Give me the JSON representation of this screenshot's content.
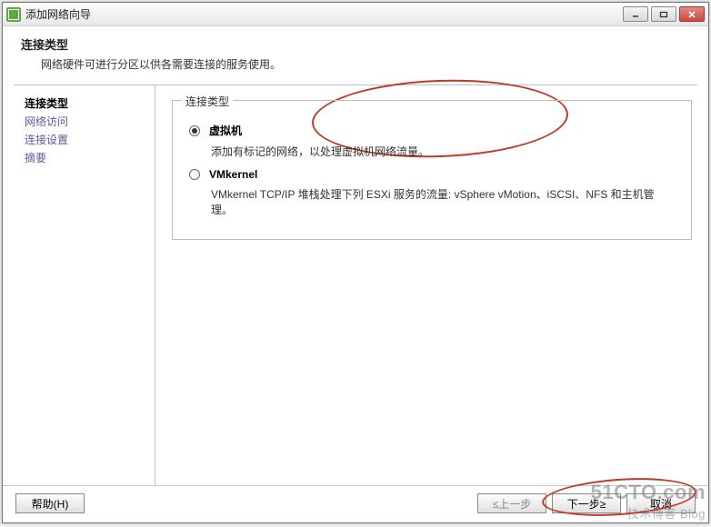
{
  "window": {
    "title": "添加网络向导"
  },
  "header": {
    "title": "连接类型",
    "description": "网络硬件可进行分区以供各需要连接的服务使用。"
  },
  "sidebar": {
    "items": [
      {
        "label": "连接类型",
        "active": true
      },
      {
        "label": "网络访问"
      },
      {
        "label": "连接设置"
      },
      {
        "label": "摘要"
      }
    ]
  },
  "main": {
    "legend": "连接类型",
    "options": [
      {
        "key": "vm",
        "label": "虚拟机",
        "description": "添加有标记的网络，以处理虚拟机网络流量。",
        "selected": true
      },
      {
        "key": "vmkernel",
        "label": "VMkernel",
        "description": "VMkernel TCP/IP 堆栈处理下列 ESXi 服务的流量: vSphere vMotion、iSCSI、NFS 和主机管理。",
        "selected": false
      }
    ]
  },
  "footer": {
    "help_label": "帮助(H)",
    "back_label": "≤上一步",
    "next_label": "下一步≥",
    "cancel_label": "取消"
  },
  "watermark": {
    "line1": "51CTO.com",
    "line2": "技术博客 Blog"
  }
}
